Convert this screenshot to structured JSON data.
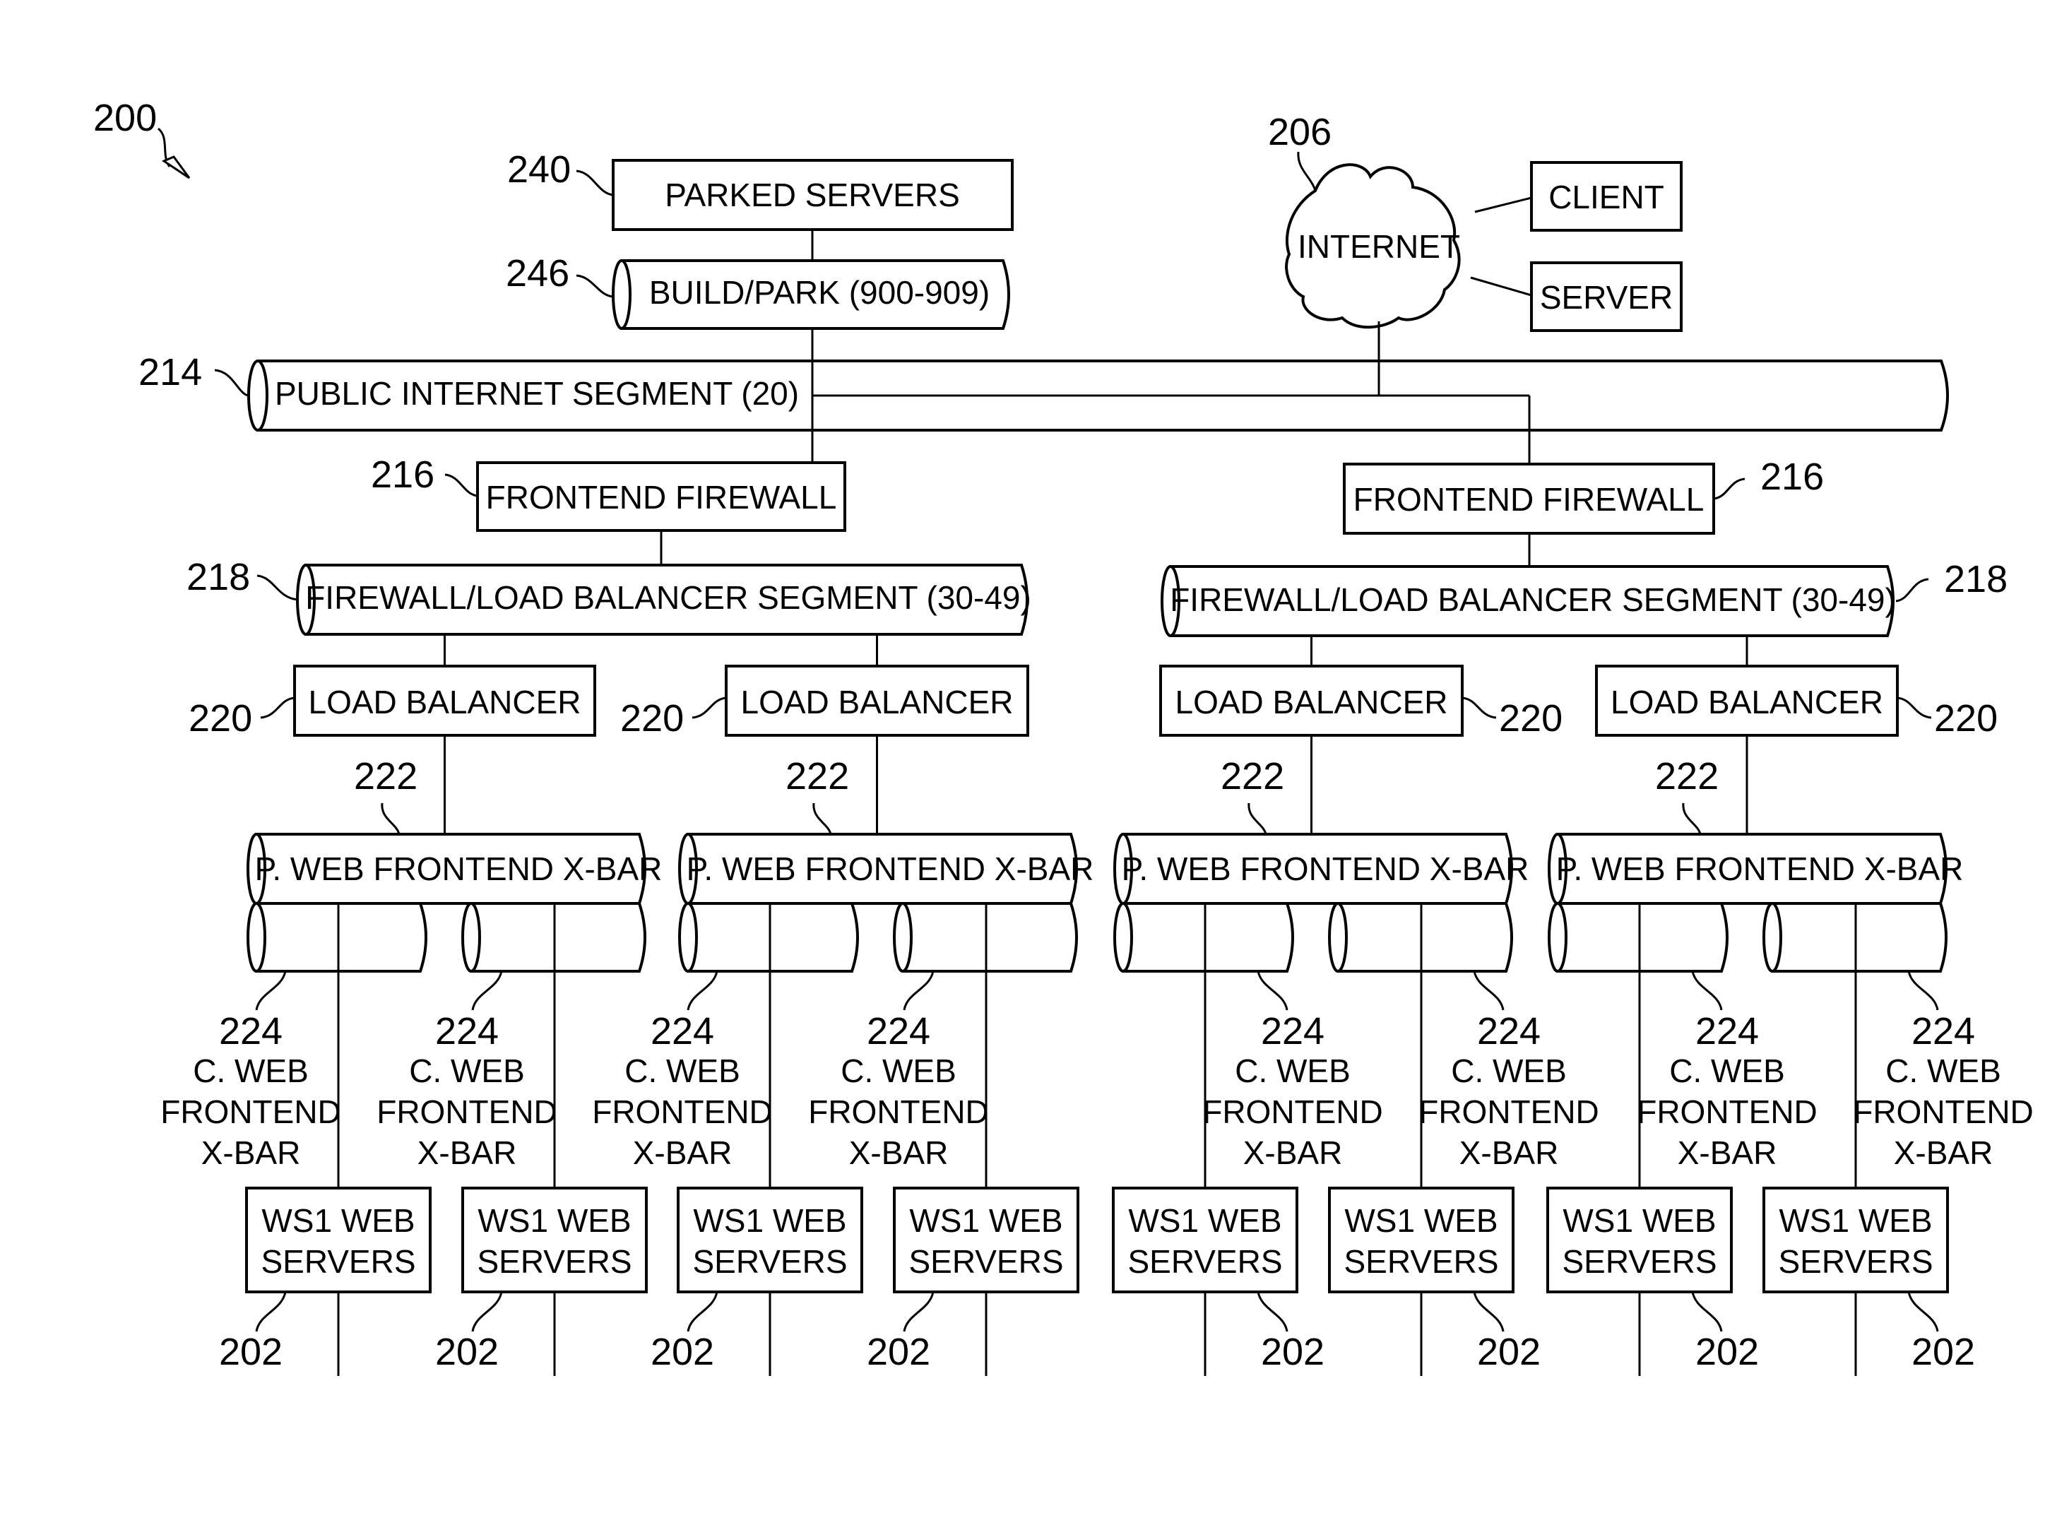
{
  "figure": {
    "ref": "200",
    "parked_servers": {
      "ref": "240",
      "label": "PARKED SERVERS"
    },
    "build_park": {
      "ref": "246",
      "label": "BUILD/PARK (900-909)"
    },
    "internet": {
      "ref": "206",
      "label": "INTERNET"
    },
    "client": {
      "label": "CLIENT"
    },
    "server": {
      "label": "SERVER"
    },
    "public_segment": {
      "ref": "214",
      "label": "PUBLIC INTERNET SEGMENT (20)"
    },
    "frontend_firewalls": [
      {
        "ref": "216",
        "label": "FRONTEND FIREWALL"
      },
      {
        "ref": "216",
        "label": "FRONTEND FIREWALL"
      }
    ],
    "fw_lb_segments": [
      {
        "ref": "218",
        "label": "FIREWALL/LOAD BALANCER SEGMENT (30-49)"
      },
      {
        "ref": "218",
        "label": "FIREWALL/LOAD BALANCER SEGMENT (30-49)"
      }
    ],
    "load_balancers": [
      {
        "ref": "220",
        "label": "LOAD BALANCER"
      },
      {
        "ref": "220",
        "label": "LOAD BALANCER"
      },
      {
        "ref": "220",
        "label": "LOAD BALANCER"
      },
      {
        "ref": "220",
        "label": "LOAD BALANCER"
      }
    ],
    "p_web_xbars": [
      {
        "ref": "222",
        "label": "P. WEB FRONTEND X-BAR"
      },
      {
        "ref": "222",
        "label": "P. WEB FRONTEND X-BAR"
      },
      {
        "ref": "222",
        "label": "P. WEB FRONTEND X-BAR"
      },
      {
        "ref": "222",
        "label": "P. WEB FRONTEND X-BAR"
      }
    ],
    "c_web_xbar": {
      "ref": "224",
      "lines": [
        "C. WEB",
        "FRONTEND",
        "X-BAR"
      ]
    },
    "web_servers": {
      "ref": "202",
      "lines": [
        "WS1 WEB",
        "SERVERS"
      ],
      "count": 8
    }
  }
}
